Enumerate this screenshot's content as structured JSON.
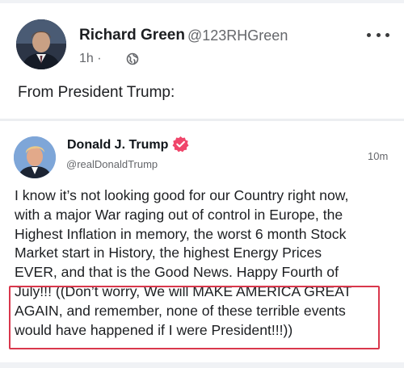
{
  "post": {
    "author_name": "Richard Green",
    "author_handle": "@123RHGreen",
    "time": "1h",
    "time_separator": "·",
    "caption": "From President Trump:"
  },
  "tweet": {
    "author_name": "Donald J. Trump",
    "author_handle": "@realDonaldTrump",
    "time": "10m",
    "body_lines": [
      "I know it’s not looking good for our Country right now,",
      "with a major War raging out of control in Europe, the",
      "Highest Inflation in memory, the worst 6 month Stock",
      "Market start in History, the highest Energy Prices",
      "EVER, and that is the Good News. Happy Fourth of",
      "July!!! ((Don’t worry, We will MAKE AMERICA GREAT",
      "AGAIN, and remember, none of these terrible events",
      "would have happened if I were President!!!))"
    ]
  },
  "colors": {
    "verified_badge": "#f0466b",
    "highlight_border": "#d9374c",
    "secondary_text": "#65676b"
  },
  "icons": {
    "privacy": "globe-icon",
    "more": "more-horizontal-icon",
    "verified": "verified-badge-icon"
  }
}
